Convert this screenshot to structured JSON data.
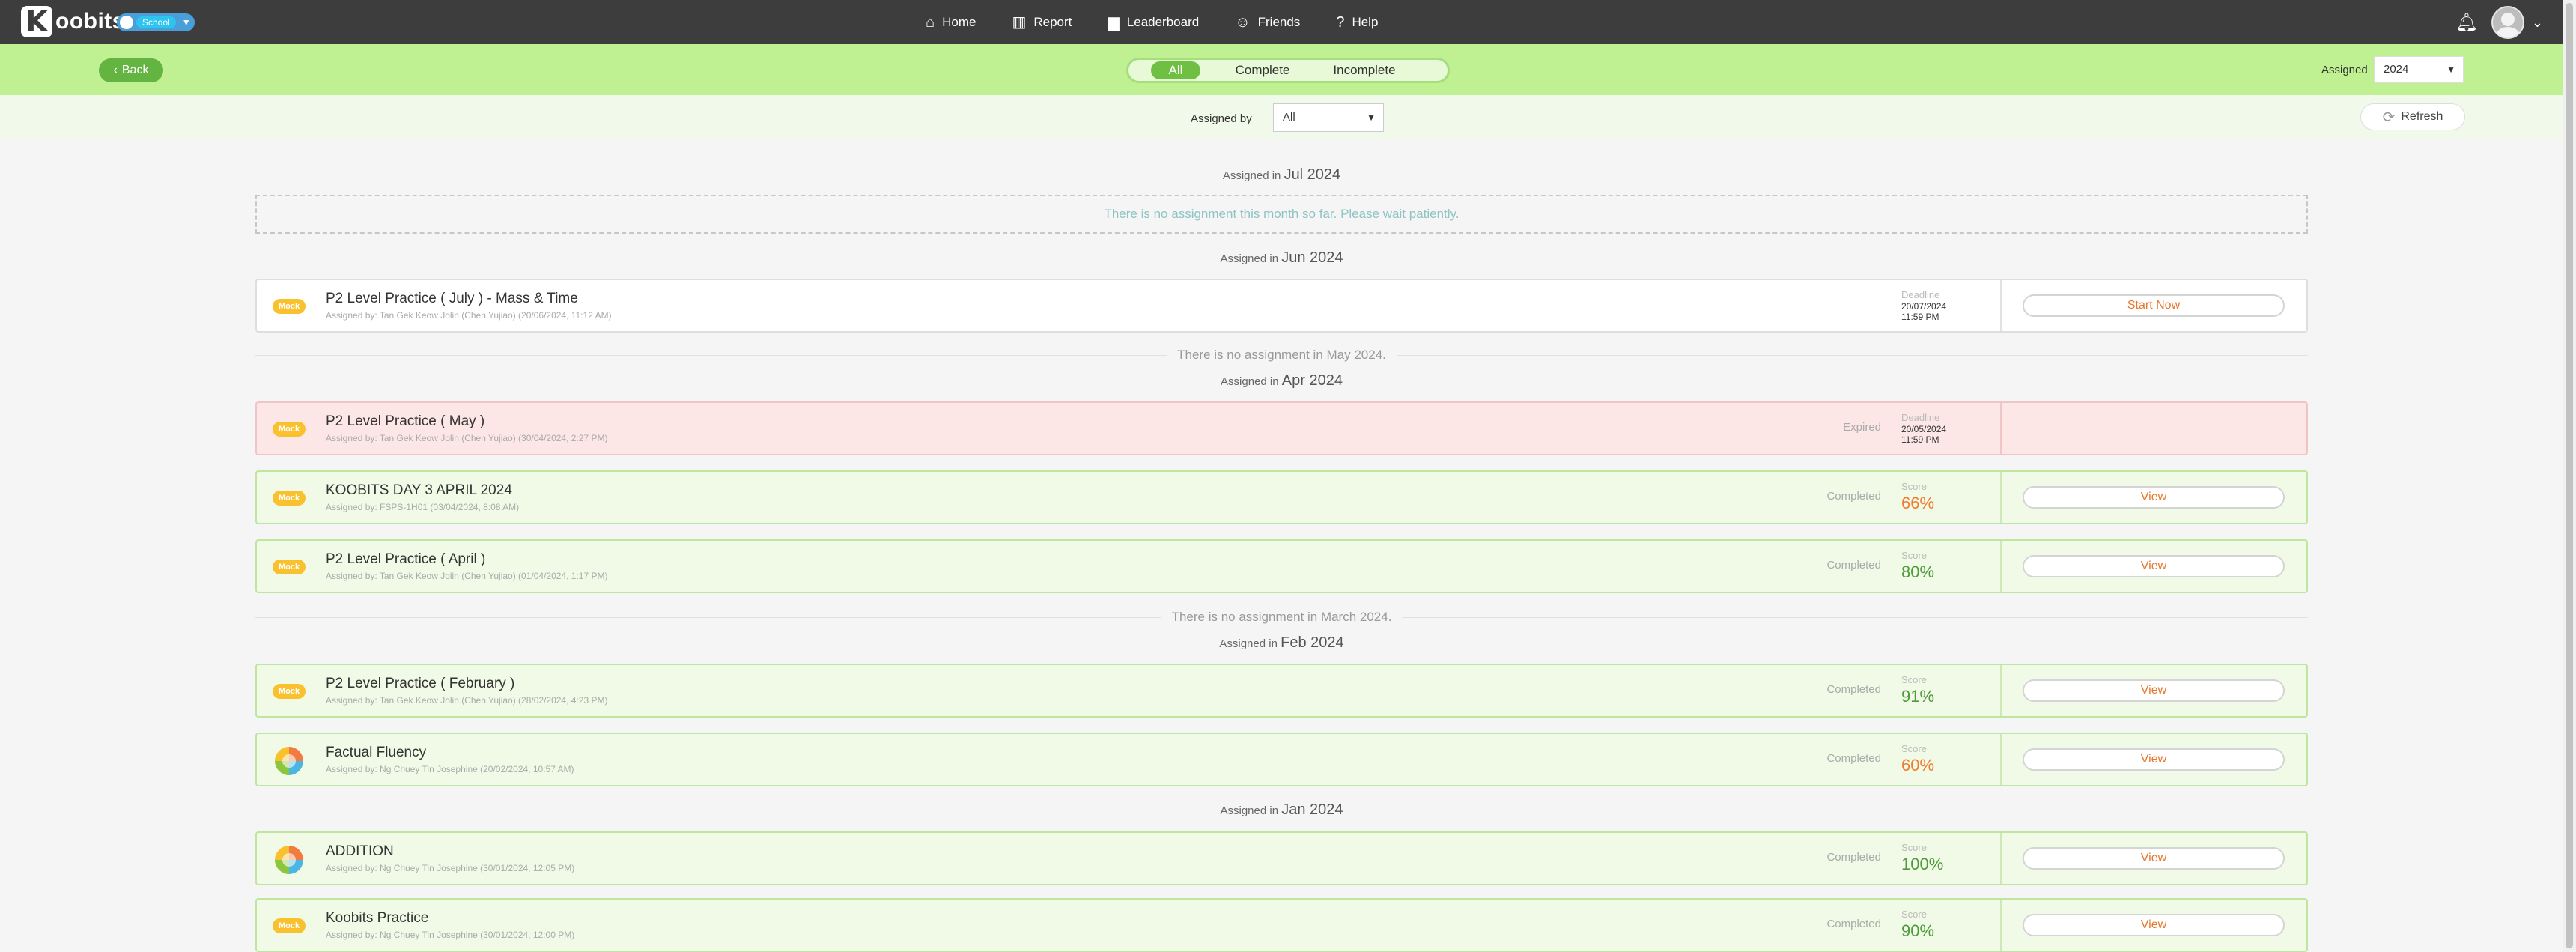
{
  "app": {
    "logo_text": "oobits",
    "logo_k": "K",
    "school_tag": "School"
  },
  "nav": {
    "items": [
      {
        "label": "Home",
        "icon": "home-icon"
      },
      {
        "label": "Report",
        "icon": "report-icon"
      },
      {
        "label": "Leaderboard",
        "icon": "leaderboard-icon"
      },
      {
        "label": "Friends",
        "icon": "friends-icon"
      },
      {
        "label": "Help",
        "icon": "help-icon"
      }
    ]
  },
  "filters": {
    "back_label": "Back",
    "tabs": [
      "All",
      "Complete",
      "Incomplete"
    ],
    "active_tab": "All",
    "assigned_label": "Assigned",
    "year": "2024",
    "assigned_by_label": "Assigned by",
    "assigned_by_value": "All",
    "refresh_label": "Refresh"
  },
  "sections": {
    "jul": {
      "prefix": "Assigned in",
      "month": "Jul 2024"
    },
    "jul_empty": "There is no assignment this month so far. Please wait patiently.",
    "jun": {
      "prefix": "Assigned in",
      "month": "Jun 2024"
    },
    "may_notice": "There is no assignment in May 2024.",
    "apr": {
      "prefix": "Assigned in",
      "month": "Apr 2024"
    },
    "mar_notice": "There is no assignment in March 2024.",
    "feb": {
      "prefix": "Assigned in",
      "month": "Feb 2024"
    },
    "jan": {
      "prefix": "Assigned in",
      "month": "Jan 2024"
    }
  },
  "assignments": [
    {
      "badge": "Mock",
      "title": "P2 Level Practice ( July ) - Mass & Time",
      "sub": "Assigned by: Tan Gek Keow Jolin (Chen Yujiao) (20/06/2024, 11:12 AM)",
      "status": "",
      "meta_label": "Deadline",
      "meta_line1": "20/07/2024",
      "meta_line2": "11:59 PM",
      "action": "Start Now"
    },
    {
      "badge": "Mock",
      "title": "P2 Level Practice ( May )",
      "sub": "Assigned by: Tan Gek Keow Jolin (Chen Yujiao) (30/04/2024, 2:27 PM)",
      "status": "Expired",
      "meta_label": "Deadline",
      "meta_line1": "20/05/2024",
      "meta_line2": "11:59 PM",
      "action": ""
    },
    {
      "badge": "Mock",
      "title": "KOOBITS DAY 3 APRIL 2024",
      "sub": "Assigned by: FSPS-1H01 (03/04/2024, 8:08 AM)",
      "status": "Completed",
      "meta_label": "Score",
      "score": "66%",
      "action": "View"
    },
    {
      "badge": "Mock",
      "title": "P2 Level Practice ( April )",
      "sub": "Assigned by: Tan Gek Keow Jolin (Chen Yujiao) (01/04/2024, 1:17 PM)",
      "status": "Completed",
      "meta_label": "Score",
      "score": "80%",
      "action": "View"
    },
    {
      "badge": "Mock",
      "title": "P2 Level Practice ( February )",
      "sub": "Assigned by: Tan Gek Keow Jolin (Chen Yujiao) (28/02/2024, 4:23 PM)",
      "status": "Completed",
      "meta_label": "Score",
      "score": "91%",
      "action": "View"
    },
    {
      "badge": "",
      "title": "Factual Fluency",
      "sub": "Assigned by: Ng Chuey Tin Josephine (20/02/2024, 10:57 AM)",
      "status": "Completed",
      "meta_label": "Score",
      "score": "60%",
      "action": "View"
    },
    {
      "badge": "",
      "title": "ADDITION",
      "sub": "Assigned by: Ng Chuey Tin Josephine (30/01/2024, 12:05 PM)",
      "status": "Completed",
      "meta_label": "Score",
      "score": "100%",
      "action": "View"
    },
    {
      "badge": "Mock",
      "title": "Koobits Practice",
      "sub": "Assigned by: Ng Chuey Tin Josephine (30/01/2024, 12:00 PM)",
      "status": "Completed",
      "meta_label": "Score",
      "score": "90%",
      "action": "View"
    }
  ],
  "colors": {
    "accent_green": "#6fc042",
    "filter_bar": "#bff092",
    "score_orange": "#f07b2e",
    "score_green": "#4f9a3a",
    "expired_bg": "#fde6e6"
  }
}
